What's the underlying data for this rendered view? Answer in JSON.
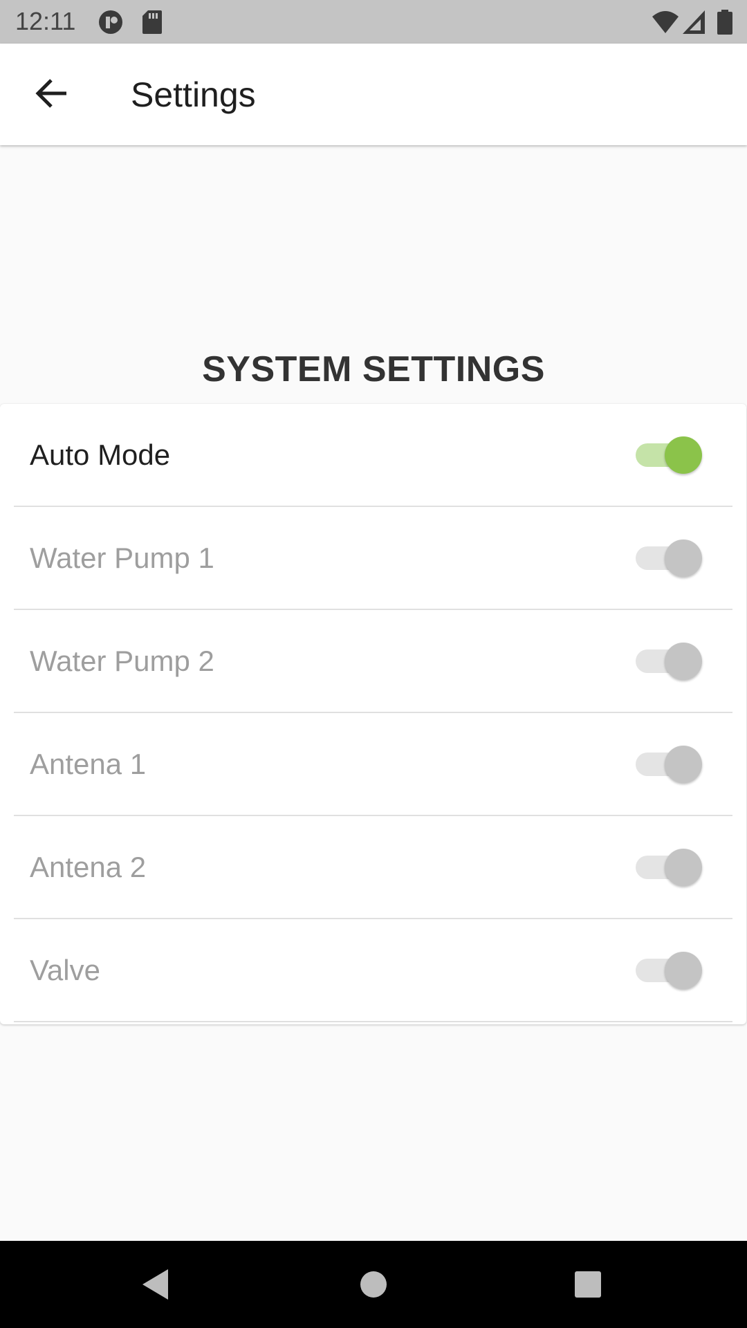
{
  "status_bar": {
    "time": "12:11",
    "icons": [
      "app-notification-icon",
      "sd-card-icon",
      "wifi-icon",
      "cell-signal-icon",
      "battery-icon"
    ]
  },
  "app_bar": {
    "back_icon": "arrow-back-icon",
    "title": "Settings"
  },
  "section": {
    "heading": "SYSTEM SETTINGS"
  },
  "settings": [
    {
      "label": "Auto Mode",
      "enabled": true,
      "on": true
    },
    {
      "label": "Water Pump 1",
      "enabled": false,
      "on": true
    },
    {
      "label": "Water Pump 2",
      "enabled": false,
      "on": true
    },
    {
      "label": "Antena 1",
      "enabled": false,
      "on": true
    },
    {
      "label": "Antena 2",
      "enabled": false,
      "on": true
    },
    {
      "label": "Valve",
      "enabled": false,
      "on": true
    }
  ],
  "colors": {
    "accent_thumb": "#8bc34a",
    "accent_track": "#c5e3a8",
    "disabled_thumb": "#c4c4c4",
    "disabled_track": "#e4e4e4",
    "disabled_text": "#9e9e9e"
  },
  "nav_bar": {
    "icons": [
      "nav-back-icon",
      "nav-home-icon",
      "nav-recents-icon"
    ]
  }
}
